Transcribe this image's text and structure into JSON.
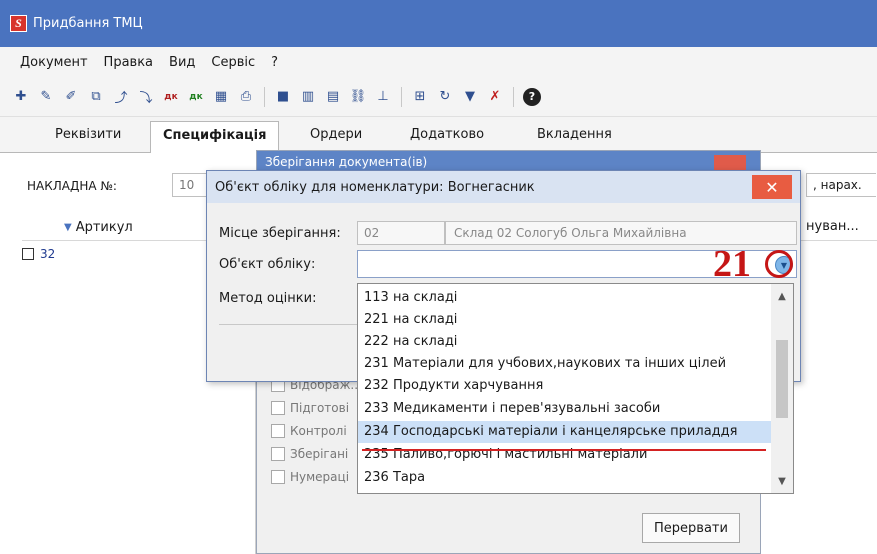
{
  "window": {
    "logo": "S",
    "title": "Придбання ТМЦ"
  },
  "menu": [
    "Документ",
    "Правка",
    "Вид",
    "Сервіс",
    "?"
  ],
  "tabs": [
    "Реквізити",
    "Специфікація",
    "Ордери",
    "Додатково",
    "Вкладення"
  ],
  "header": {
    "nakl_label": "НАКЛАДНА №:",
    "nakl_value": "10",
    "narakh": ", нарах."
  },
  "grid": {
    "col_article": "Артикул",
    "col_right": "нуван...",
    "row_value": "32"
  },
  "bg_dialog": {
    "title": "Зберігання документа(ів)",
    "checks": [
      "Відображ...",
      "Підготові",
      "Контролі",
      "Зберігані",
      "Нумераці"
    ],
    "abort_label": "Перервати"
  },
  "dialog": {
    "title": "Об'єкт обліку для номенклатури: Вогнегасник",
    "close": "✕",
    "storage_label": "Місце зберігання:",
    "storage_code": "02",
    "storage_name": "Склад 02 Сологуб Ольга Михайлівна",
    "object_label": "Об'єкт обліку:",
    "object_value": "",
    "method_label": "Метод оцінки:"
  },
  "dropdown": {
    "items": [
      "113 на складі",
      "221 на складі",
      "222 на складі",
      "231 Матеріали для учбових,наукових та інших цілей",
      "232  Продукти харчування",
      "233 Медикаменти і перев'язувальні засоби",
      "234 Господарські матеріали і канцелярське приладдя",
      "235 Паливо,горючі і мастильні матеріали",
      "236 Тара"
    ],
    "selected_index": 6
  },
  "annotation": {
    "step": "21"
  },
  "colors": {
    "titlebar": "#4a73bf",
    "close": "#e85c41",
    "selected": "#cce0f7",
    "annotation": "#c51616"
  }
}
